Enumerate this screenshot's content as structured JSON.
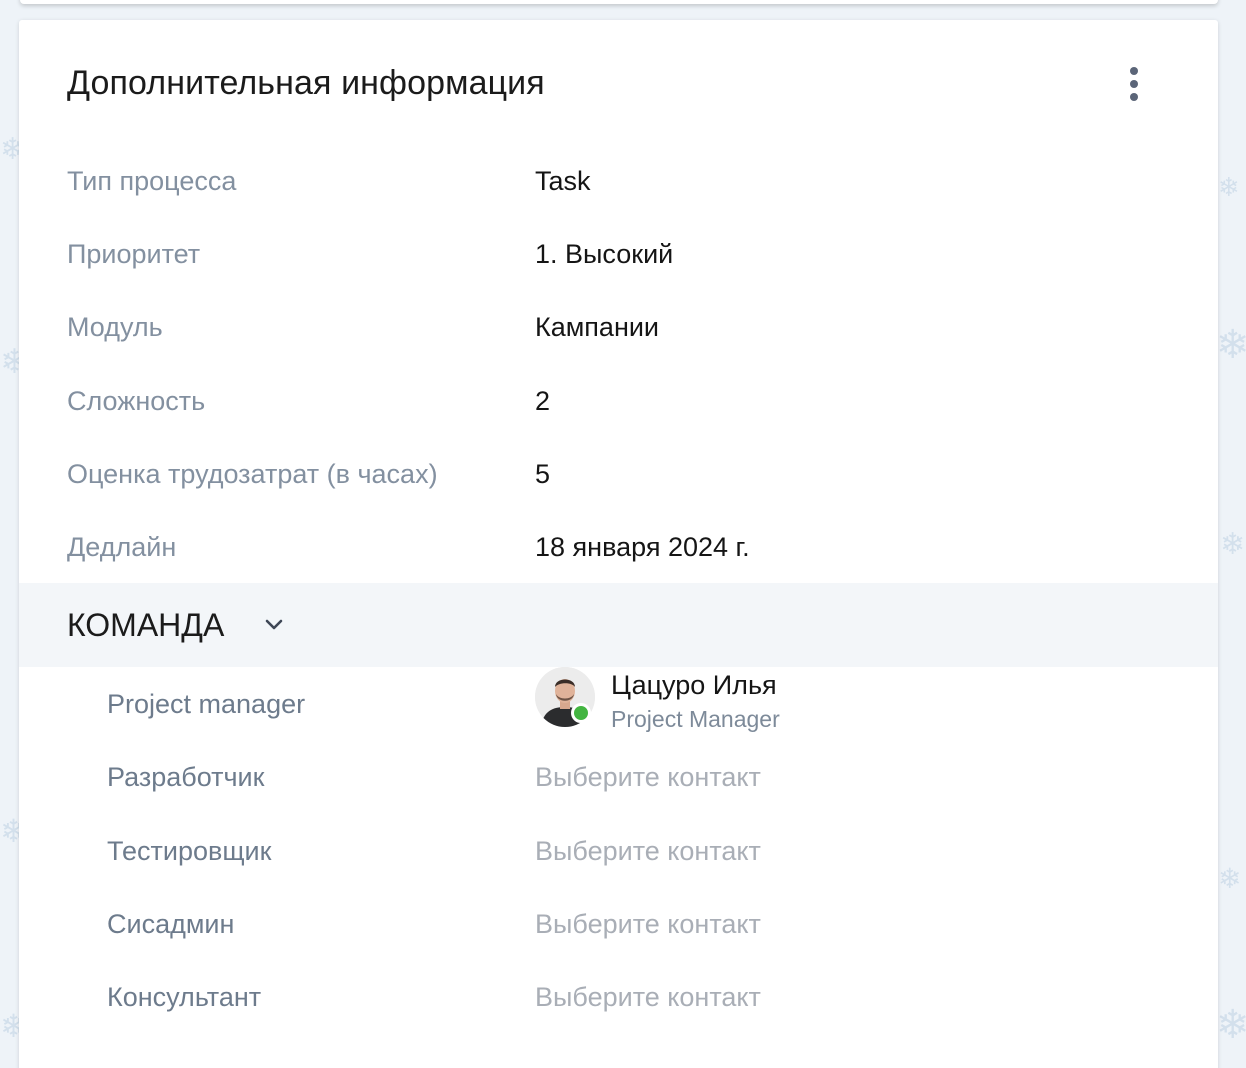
{
  "card": {
    "title": "Дополнительная информация",
    "menu_icon": "more-vertical-icon"
  },
  "fields": [
    {
      "label": "Тип процесса",
      "value": "Task"
    },
    {
      "label": "Приоритет",
      "value": "1. Высокий"
    },
    {
      "label": "Модуль",
      "value": "Кампании"
    },
    {
      "label": "Сложность",
      "value": "2"
    },
    {
      "label": "Оценка трудозатрат (в часах)",
      "value": "5"
    },
    {
      "label": "Дедлайн",
      "value": "18 января 2024 г."
    }
  ],
  "team": {
    "title": "КОМАНДА",
    "toggle_icon": "chevron-down-icon",
    "roles": [
      {
        "label": "Project manager",
        "contact_name": "Цацуро Илья",
        "contact_role": "Project Manager",
        "status": "online"
      },
      {
        "label": "Разработчик",
        "placeholder": "Выберите контакт"
      },
      {
        "label": "Тестировщик",
        "placeholder": "Выберите контакт"
      },
      {
        "label": "Сисадмин",
        "placeholder": "Выберите контакт"
      },
      {
        "label": "Консультант",
        "placeholder": "Выберите контакт"
      }
    ]
  },
  "colors": {
    "status_online": "#43b541",
    "section_bg": "#f3f6f9",
    "label_color": "#8390a0",
    "placeholder_color": "#a9aeb6"
  }
}
